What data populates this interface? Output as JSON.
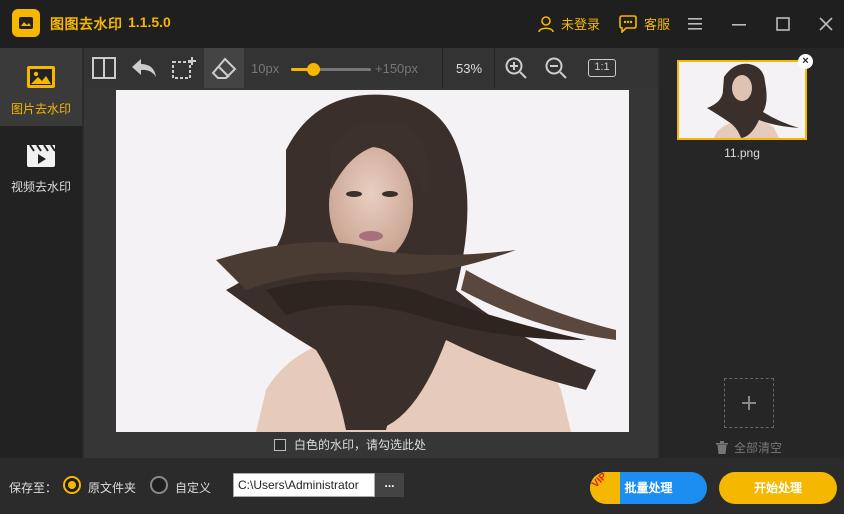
{
  "titlebar": {
    "app_name": "图图去水印",
    "version": "1.1.5.0",
    "login_label": "未登录",
    "service_label": "客服",
    "menu_icon": "hamburger-icon",
    "minimize_icon": "minimize-icon",
    "maximize_icon": "maximize-icon",
    "close_icon": "close-icon"
  },
  "leftnav": {
    "items": [
      {
        "label": "图片去水印",
        "icon": "image-icon",
        "active": true
      },
      {
        "label": "视频去水印",
        "icon": "video-icon",
        "active": false
      }
    ]
  },
  "toolbar": {
    "tools": [
      "compare-icon",
      "undo-icon",
      "select-rect-icon",
      "eraser-icon"
    ],
    "brush_min": "10px",
    "brush_max": "+150px",
    "brush_level": 0.28,
    "zoom": "53%",
    "zoom_in_icon": "zoom-in-icon",
    "zoom_out_icon": "zoom-out-icon",
    "actual_size": "1:1"
  },
  "canvas": {
    "white_watermark_label": "白色的水印，请勾选此处",
    "white_watermark_checked": false
  },
  "rightpanel": {
    "files": [
      {
        "name": "11.png"
      }
    ],
    "clear_all_label": "全部清空"
  },
  "bottombar": {
    "save_to_label": "保存至：",
    "option_original": "原文件夹",
    "option_custom": "自定义",
    "selected_option": "original",
    "path_value": "C:\\Users\\Administrator",
    "browse_label": "...",
    "batch_label": "批量处理",
    "vip_label": "VIP",
    "start_label": "开始处理"
  },
  "colors": {
    "accent": "#f5b700",
    "batch_blue": "#1c8ef2",
    "background": "#2b2b2b"
  }
}
